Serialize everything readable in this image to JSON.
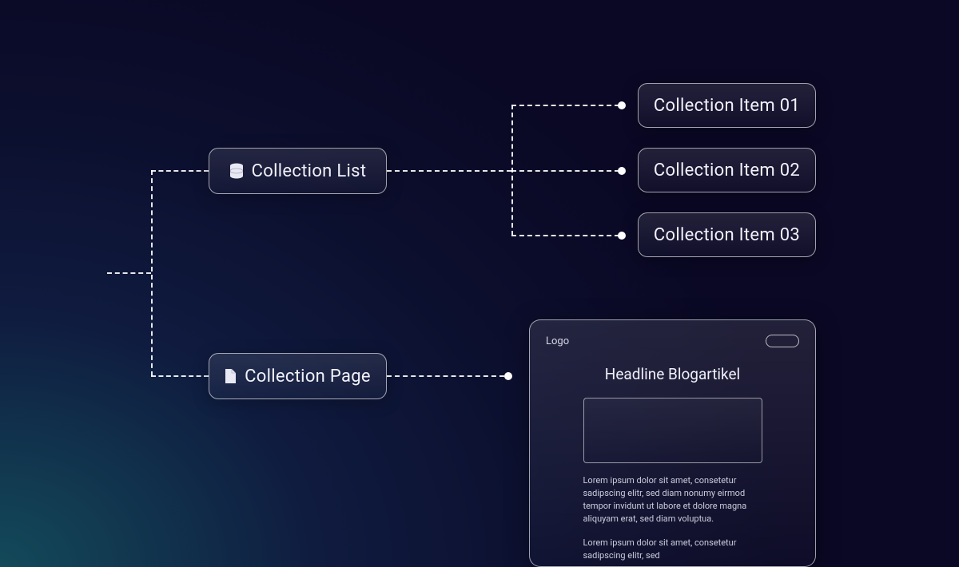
{
  "nodes": {
    "collection_list": "Collection List",
    "collection_page": "Collection Page",
    "items": [
      "Collection Item 01",
      "Collection Item 02",
      "Collection Item 03"
    ]
  },
  "preview": {
    "logo": "Logo",
    "headline": "Headline Blogartikel",
    "paragraphs": [
      "Lorem ipsum dolor sit amet, consetetur sadipscing elitr,  sed diam nonumy eirmod  tempor invidunt ut labore et  dolore magna aliquyam erat,  sed diam voluptua.",
      "Lorem ipsum dolor sit amet, consetetur sadipscing elitr,  sed"
    ]
  }
}
